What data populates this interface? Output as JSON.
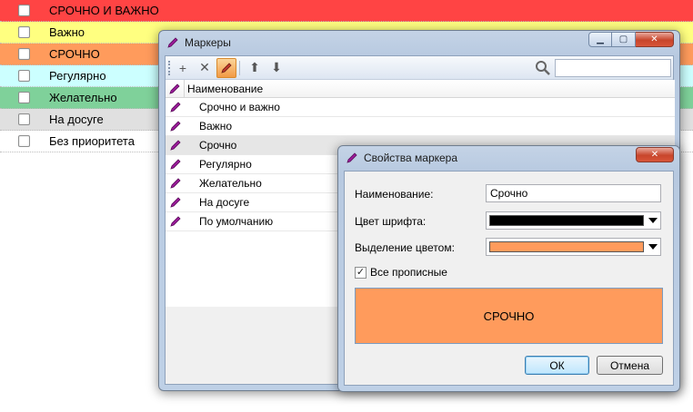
{
  "tasks": [
    {
      "text": "СРОЧНО И ВАЖНО",
      "bg": "#ff4444"
    },
    {
      "text": "Важно",
      "bg": "#ffff80"
    },
    {
      "text": "СРОЧНО",
      "bg": "#ff9b5c"
    },
    {
      "text": "Регулярно",
      "bg": "#ccffff"
    },
    {
      "text": "Желательно",
      "bg": "#7fd19a"
    },
    {
      "text": "На досуге",
      "bg": "#e0e0e0"
    },
    {
      "text": "Без приоритета",
      "bg": "#ffffff"
    }
  ],
  "markers_window": {
    "title": "Маркеры",
    "toolbar": {
      "add_icon": "plus-icon",
      "delete_icon": "cross-icon",
      "edit_icon": "pencil-icon",
      "up_icon": "arrow-up-icon",
      "down_icon": "arrow-down-icon",
      "search_icon": "magnifier-icon",
      "search_value": ""
    },
    "column_header": "Наименование",
    "items": [
      "Срочно и важно",
      "Важно",
      "Срочно",
      "Регулярно",
      "Желательно",
      "На досуге",
      "По умолчанию"
    ],
    "selected_index": 2
  },
  "props_dialog": {
    "title": "Свойства маркера",
    "name_label": "Наименование:",
    "name_value": "Срочно",
    "font_color_label": "Цвет шрифта:",
    "font_color": "#000000",
    "highlight_label": "Выделение цветом:",
    "highlight_color": "#ff9b5c",
    "uppercase_label": "Все прописные",
    "uppercase_checked": true,
    "preview_text": "СРОЧНО",
    "ok_label": "ОК",
    "cancel_label": "Отмена"
  },
  "colors": {
    "pencil": "#9b1b9a",
    "accent_orange": "#f29a45"
  }
}
